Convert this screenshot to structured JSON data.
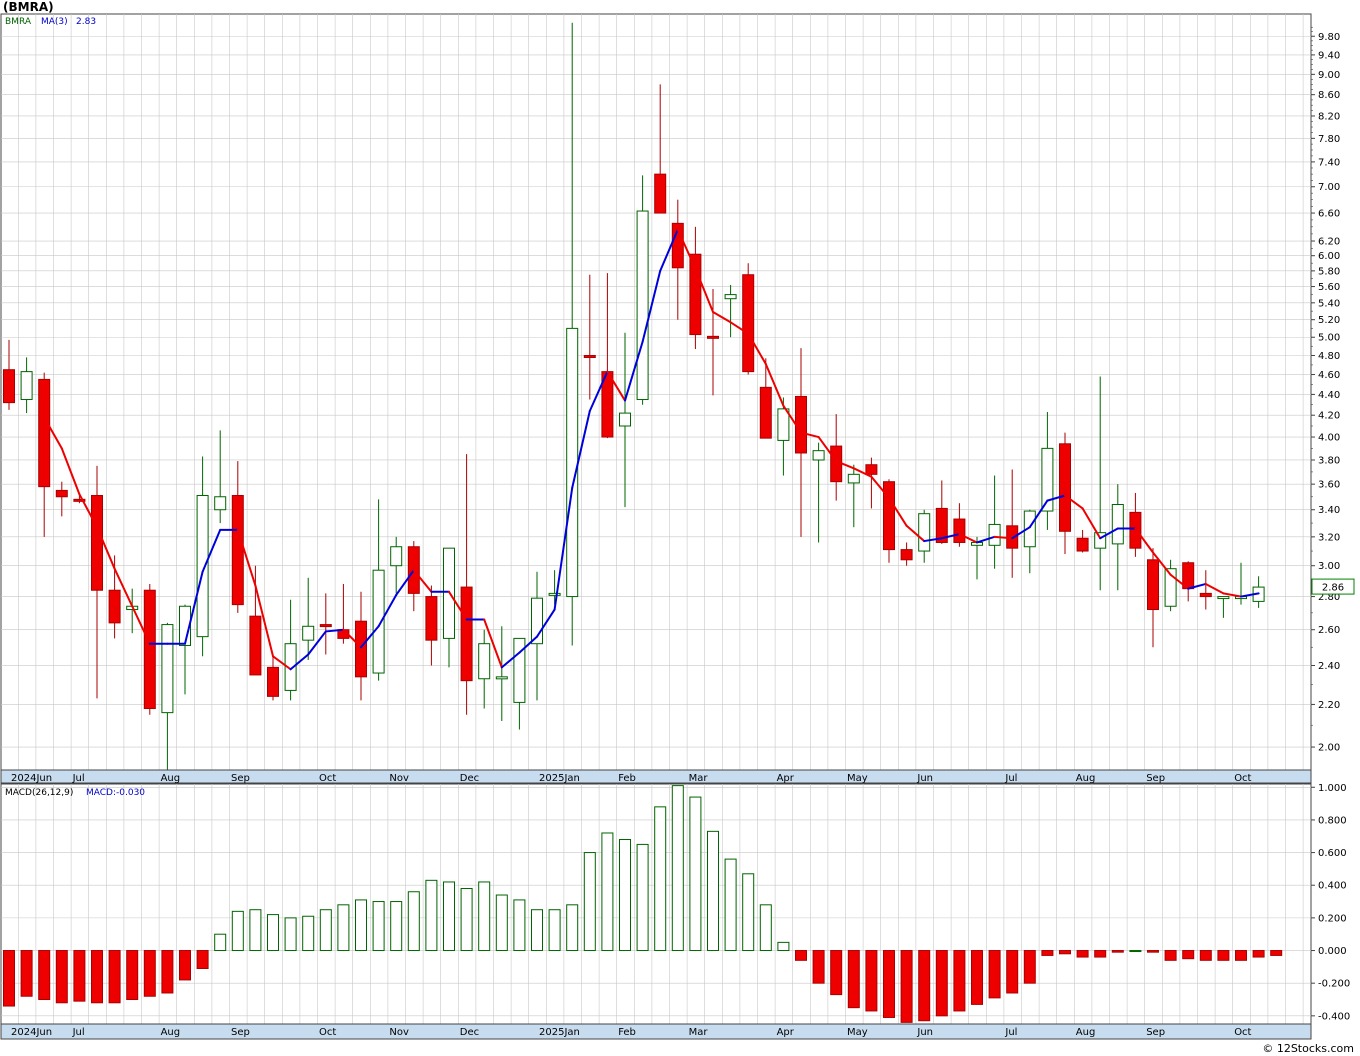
{
  "title": "(BMRA)",
  "credit": "© 12Stocks.com",
  "colors": {
    "up_body": "#ffffff",
    "up_border": "#006400",
    "down_body": "#ee0000",
    "down_border": "#aa0000",
    "wick_up": "#006400",
    "wick_down": "#aa0000",
    "ma_up": "#0000dd",
    "ma_down": "#ee0000",
    "axis_bar": "#c8dcf0",
    "grid": "#c0c0c0",
    "legend_ticker": "#006400",
    "legend_ma": "#0000cc"
  },
  "price_panel": {
    "legend": {
      "ticker": "BMRA",
      "ma_label": "MA(3)",
      "ma_value": "2.83"
    },
    "last_price_label": "2.86",
    "y_ticks": [
      "2.00",
      "2.20",
      "2.40",
      "2.60",
      "2.80",
      "3.00",
      "3.20",
      "3.40",
      "3.60",
      "3.80",
      "4.00",
      "4.20",
      "4.40",
      "4.60",
      "4.80",
      "5.00",
      "5.20",
      "5.40",
      "5.60",
      "5.80",
      "6.00",
      "6.20",
      "6.60",
      "7.00",
      "7.40",
      "7.80",
      "8.20",
      "8.60",
      "9.00",
      "9.40",
      "9.80"
    ]
  },
  "macd_panel": {
    "legend": {
      "label": "MACD(26,12,9)",
      "value": "MACD:-0.030"
    },
    "y_ticks": [
      "-0.400",
      "-0.200",
      "0.000",
      "0.200",
      "0.400",
      "0.600",
      "0.800",
      "1.000"
    ]
  },
  "x_labels": [
    {
      "text": "2024Jun",
      "i": 0.5
    },
    {
      "text": "Jul",
      "i": 4
    },
    {
      "text": "Aug",
      "i": 9
    },
    {
      "text": "Sep",
      "i": 13
    },
    {
      "text": "Oct",
      "i": 18
    },
    {
      "text": "Nov",
      "i": 22
    },
    {
      "text": "Dec",
      "i": 26
    },
    {
      "text": "2025Jan",
      "i": 30.5
    },
    {
      "text": "Feb",
      "i": 35
    },
    {
      "text": "Mar",
      "i": 39
    },
    {
      "text": "Apr",
      "i": 44
    },
    {
      "text": "May",
      "i": 48
    },
    {
      "text": "Jun",
      "i": 52
    },
    {
      "text": "Jul",
      "i": 57
    },
    {
      "text": "Aug",
      "i": 61
    },
    {
      "text": "Sep",
      "i": 65
    },
    {
      "text": "Oct",
      "i": 70
    }
  ],
  "chart_data": [
    {
      "type": "candlestick",
      "title": "(BMRA)",
      "scale": "log",
      "ylim": [
        1.9,
        10.3
      ],
      "series": [
        {
          "name": "BMRA",
          "ohlc": [
            [
              4.65,
              4.97,
              4.25,
              4.32
            ],
            [
              4.35,
              4.78,
              4.22,
              4.63
            ],
            [
              4.55,
              4.62,
              3.2,
              3.58
            ],
            [
              3.55,
              3.62,
              3.35,
              3.5
            ],
            [
              3.48,
              3.52,
              3.45,
              3.47
            ],
            [
              3.51,
              3.75,
              2.23,
              2.84
            ],
            [
              2.84,
              3.07,
              2.55,
              2.64
            ],
            [
              2.72,
              2.85,
              2.58,
              2.74
            ],
            [
              2.84,
              2.88,
              2.15,
              2.18
            ],
            [
              2.16,
              2.64,
              1.9,
              2.63
            ],
            [
              2.51,
              2.75,
              2.25,
              2.74
            ],
            [
              2.56,
              3.83,
              2.45,
              3.51
            ],
            [
              3.4,
              4.06,
              3.3,
              3.5
            ],
            [
              3.51,
              3.79,
              2.7,
              2.75
            ],
            [
              2.68,
              3.0,
              2.36,
              2.35
            ],
            [
              2.39,
              2.45,
              2.22,
              2.24
            ],
            [
              2.27,
              2.78,
              2.22,
              2.52
            ],
            [
              2.54,
              2.92,
              2.43,
              2.62
            ],
            [
              2.63,
              2.82,
              2.46,
              2.62
            ],
            [
              2.6,
              2.88,
              2.52,
              2.55
            ],
            [
              2.65,
              2.83,
              2.22,
              2.34
            ],
            [
              2.36,
              3.48,
              2.32,
              2.97
            ],
            [
              3.0,
              3.2,
              2.82,
              3.13
            ],
            [
              3.13,
              3.17,
              2.71,
              2.82
            ],
            [
              2.8,
              2.87,
              2.4,
              2.54
            ],
            [
              2.55,
              2.97,
              2.39,
              3.12
            ],
            [
              2.86,
              3.85,
              2.15,
              2.32
            ],
            [
              2.33,
              2.6,
              2.18,
              2.52
            ],
            [
              2.33,
              2.62,
              2.12,
              2.34
            ],
            [
              2.21,
              2.55,
              2.08,
              2.55
            ],
            [
              2.52,
              2.96,
              2.22,
              2.79
            ],
            [
              2.81,
              2.97,
              2.75,
              2.82
            ],
            [
              2.8,
              10.1,
              2.51,
              5.1
            ],
            [
              4.8,
              5.75,
              4.35,
              4.79
            ],
            [
              4.63,
              5.77,
              3.99,
              4.0
            ],
            [
              4.1,
              5.05,
              3.42,
              4.22
            ],
            [
              4.35,
              7.18,
              4.3,
              6.63
            ],
            [
              7.2,
              8.8,
              6.6,
              6.6
            ],
            [
              6.45,
              6.8,
              5.2,
              5.84
            ],
            [
              6.02,
              6.4,
              4.87,
              5.03
            ],
            [
              5.01,
              5.57,
              4.39,
              4.99
            ],
            [
              5.45,
              5.62,
              5.0,
              5.5
            ],
            [
              5.75,
              5.9,
              4.6,
              4.63
            ],
            [
              4.47,
              4.77,
              3.99,
              3.99
            ],
            [
              3.97,
              4.37,
              3.67,
              4.26
            ],
            [
              4.38,
              4.88,
              3.2,
              3.86
            ],
            [
              3.8,
              3.95,
              3.16,
              3.88
            ],
            [
              3.92,
              4.21,
              3.47,
              3.62
            ],
            [
              3.61,
              3.76,
              3.27,
              3.68
            ],
            [
              3.76,
              3.82,
              3.41,
              3.68
            ],
            [
              3.62,
              3.64,
              3.02,
              3.11
            ],
            [
              3.11,
              3.16,
              3.0,
              3.04
            ],
            [
              3.1,
              3.4,
              3.02,
              3.37
            ],
            [
              3.41,
              3.63,
              3.15,
              3.16
            ],
            [
              3.33,
              3.45,
              3.13,
              3.16
            ],
            [
              3.14,
              3.2,
              2.91,
              3.16
            ],
            [
              3.14,
              3.67,
              2.98,
              3.29
            ],
            [
              3.28,
              3.72,
              2.92,
              3.12
            ],
            [
              3.13,
              3.4,
              2.95,
              3.39
            ],
            [
              3.39,
              4.23,
              3.25,
              3.9
            ],
            [
              3.94,
              4.04,
              3.08,
              3.24
            ],
            [
              3.19,
              3.25,
              3.09,
              3.1
            ],
            [
              3.12,
              4.58,
              2.84,
              3.23
            ],
            [
              3.15,
              3.6,
              2.84,
              3.44
            ],
            [
              3.38,
              3.53,
              3.06,
              3.12
            ],
            [
              3.04,
              3.12,
              2.5,
              2.72
            ],
            [
              2.74,
              3.04,
              2.71,
              2.98
            ],
            [
              3.02,
              3.03,
              2.77,
              2.85
            ],
            [
              2.82,
              2.97,
              2.72,
              2.8
            ],
            [
              2.8,
              2.8,
              2.67,
              2.8
            ],
            [
              2.79,
              3.02,
              2.75,
              2.8
            ],
            [
              2.77,
              2.93,
              2.73,
              2.86
            ]
          ]
        },
        {
          "name": "MA(3)",
          "values": [
            null,
            null,
            4.18,
            3.9,
            3.52,
            3.27,
            2.98,
            2.74,
            2.52,
            2.52,
            2.52,
            2.96,
            3.25,
            3.25,
            2.87,
            2.45,
            2.38,
            2.46,
            2.59,
            2.6,
            2.5,
            2.62,
            2.81,
            2.97,
            2.83,
            2.83,
            2.66,
            2.66,
            2.39,
            2.47,
            2.56,
            2.72,
            3.57,
            4.24,
            4.63,
            4.34,
            4.95,
            5.8,
            6.36,
            5.83,
            5.29,
            5.17,
            5.04,
            4.71,
            4.29,
            4.04,
            4.0,
            3.79,
            3.73,
            3.66,
            3.49,
            3.28,
            3.17,
            3.19,
            3.22,
            3.16,
            3.2,
            3.19,
            3.27,
            3.47,
            3.51,
            3.41,
            3.19,
            3.26,
            3.26,
            3.09,
            2.94,
            2.85,
            2.88,
            2.82,
            2.8,
            2.82
          ]
        }
      ]
    },
    {
      "type": "bar",
      "title": "MACD(26,12,9)",
      "ylim": [
        -0.45,
        1.02
      ],
      "series": [
        {
          "name": "MACD(26,12,9)",
          "values": [
            -0.34,
            -0.28,
            -0.3,
            -0.32,
            -0.31,
            -0.32,
            -0.32,
            -0.3,
            -0.28,
            -0.26,
            -0.18,
            -0.11,
            0.1,
            0.24,
            0.25,
            0.22,
            0.2,
            0.21,
            0.25,
            0.28,
            0.31,
            0.3,
            0.3,
            0.36,
            0.43,
            0.42,
            0.38,
            0.42,
            0.34,
            0.31,
            0.25,
            0.25,
            0.28,
            0.6,
            0.72,
            0.68,
            0.65,
            0.88,
            1.01,
            0.94,
            0.73,
            0.56,
            0.47,
            0.28,
            0.05,
            -0.06,
            -0.2,
            -0.27,
            -0.35,
            -0.37,
            -0.41,
            -0.44,
            -0.43,
            -0.4,
            -0.37,
            -0.33,
            -0.29,
            -0.26,
            -0.2,
            -0.03,
            -0.02,
            -0.04,
            -0.04,
            -0.01,
            0.0,
            -0.01,
            -0.06,
            -0.05,
            -0.06,
            -0.06,
            -0.06,
            -0.04,
            -0.03
          ]
        }
      ]
    }
  ]
}
